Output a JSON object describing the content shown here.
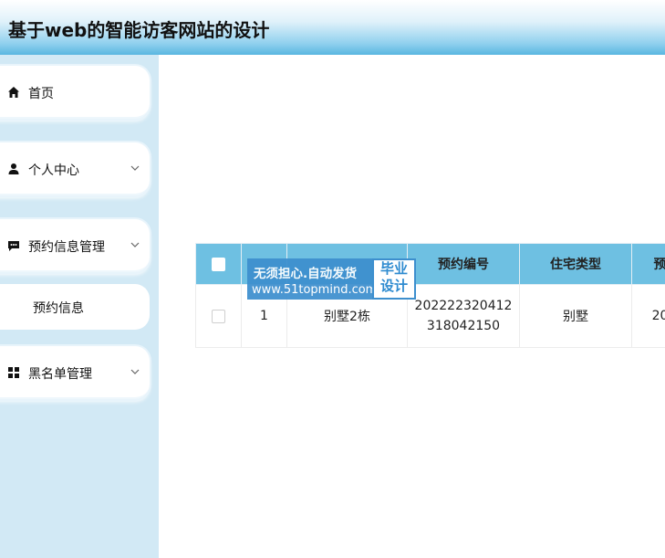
{
  "header": {
    "title": "基于web的智能访客网站的设计"
  },
  "sidebar": {
    "items": [
      {
        "label": "首页",
        "icon": "home-icon",
        "has_chevron": false
      },
      {
        "label": "个人中心",
        "icon": "user-icon",
        "has_chevron": true
      },
      {
        "label": "预约信息管理",
        "icon": "message-icon",
        "has_chevron": true
      },
      {
        "label": "黑名单管理",
        "icon": "grid-icon",
        "has_chevron": true
      }
    ],
    "submenu": {
      "label": "预约信息"
    }
  },
  "table": {
    "columns": [
      "",
      "",
      "",
      "预约编号",
      "住宅类型",
      "预"
    ],
    "rows": [
      {
        "index": "1",
        "house": "别墅2栋",
        "booking_no_line1": "202222320412",
        "booking_no_line2": "318042150",
        "house_type": "别墅",
        "next": "20"
      }
    ]
  },
  "watermark": {
    "line1": "无须担心.自动发货",
    "line2": "www.51topmind.com",
    "badge_line1": "毕业",
    "badge_line2": "设计"
  },
  "colors": {
    "header_bottom": "#5ab6e0",
    "sidebar_bg": "#d2e9f5",
    "table_header_bg": "#6ec0e2",
    "watermark_bg": "#3d8fce"
  }
}
